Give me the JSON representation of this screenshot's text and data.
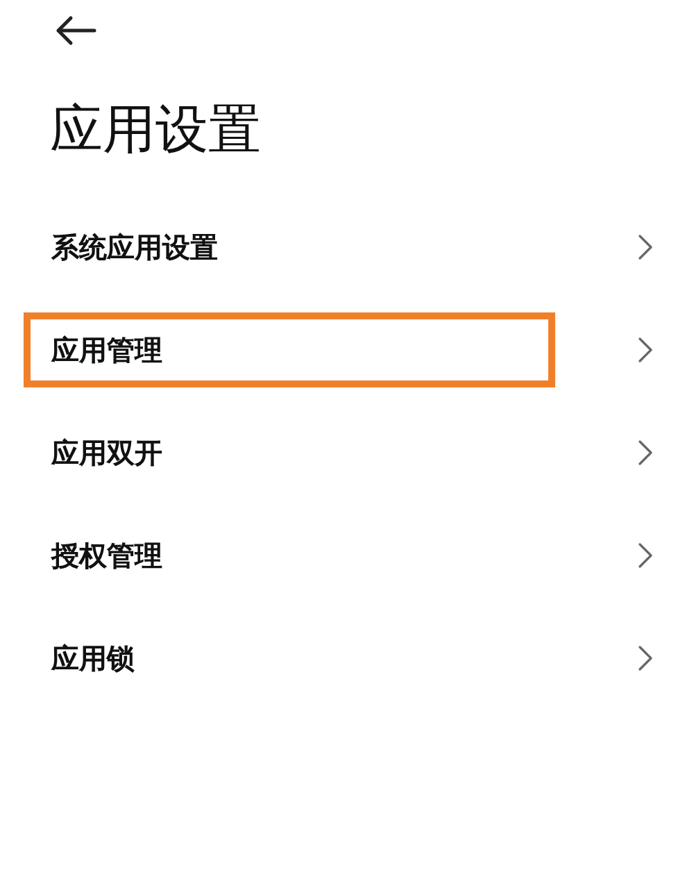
{
  "header": {
    "title": "应用设置"
  },
  "items": [
    {
      "label": "系统应用设置",
      "highlighted": false
    },
    {
      "label": "应用管理",
      "highlighted": true
    },
    {
      "label": "应用双开",
      "highlighted": false
    },
    {
      "label": "授权管理",
      "highlighted": false
    },
    {
      "label": "应用锁",
      "highlighted": false
    }
  ]
}
